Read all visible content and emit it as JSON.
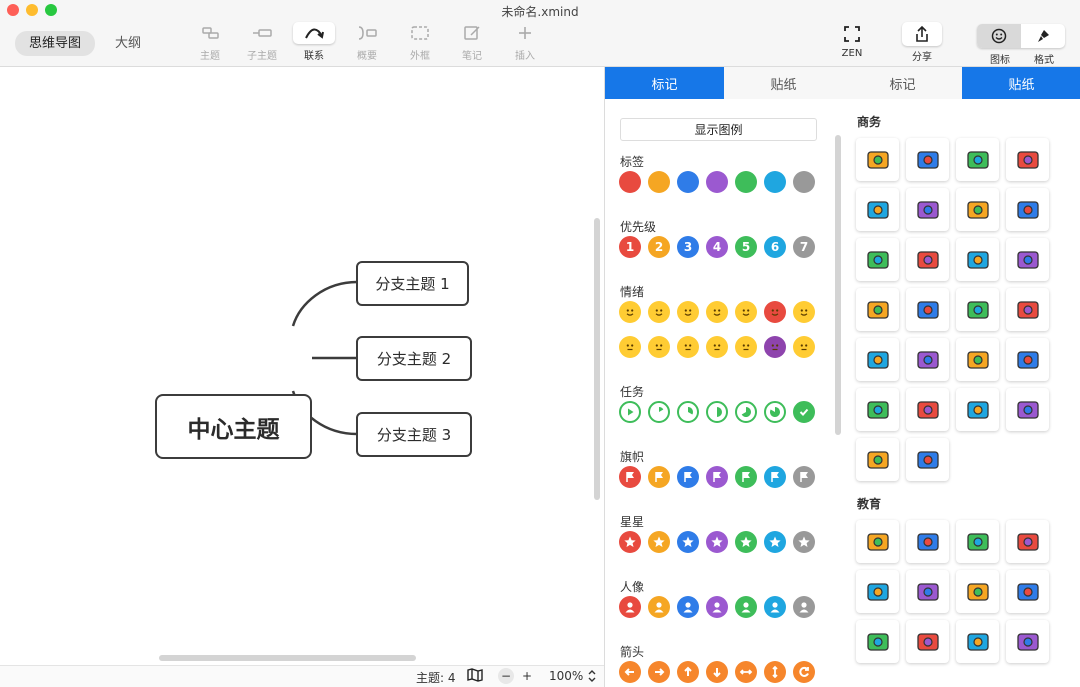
{
  "window": {
    "title": "未命名.xmind"
  },
  "view_tabs": [
    {
      "label": "思维导图",
      "active": true
    },
    {
      "label": "大纲",
      "active": false
    }
  ],
  "toolbar": {
    "topic": "主题",
    "subtopic": "子主题",
    "relationship": "联系",
    "summary": "概要",
    "boundary": "外框",
    "note": "笔记",
    "insert": "插入",
    "zen": "ZEN",
    "share": "分享",
    "icons": "图标",
    "format": "格式"
  },
  "mindmap": {
    "central": "中心主题",
    "branches": [
      "分支主题 1",
      "分支主题 2",
      "分支主题 3"
    ]
  },
  "status": {
    "topics": "主题: 4",
    "zoom": "100%",
    "minus": "−",
    "plus": "+"
  },
  "panel": {
    "tabs": [
      {
        "label": "标记",
        "active": true
      },
      {
        "label": "贴纸",
        "active": false
      },
      {
        "label": "标记",
        "active": false
      },
      {
        "label": "贴纸",
        "active": true
      }
    ],
    "show_legend": "显示图例",
    "marker_sections": {
      "tag": "标签",
      "priority": "优先级",
      "mood": "情绪",
      "task": "任务",
      "flag": "旗帜",
      "star": "星星",
      "person": "人像",
      "arrow": "箭头"
    },
    "palette": [
      "#e84a3f",
      "#f5a623",
      "#2f7ce8",
      "#9b59d0",
      "#3ebd5a",
      "#1fa6e0",
      "#999999"
    ],
    "priority_numbers": [
      "1",
      "2",
      "3",
      "4",
      "5",
      "6",
      "7"
    ],
    "sticker_sections": {
      "business": "商务",
      "education": "教育"
    },
    "business_stickers": [
      "money-icon",
      "briefcase-icon",
      "calculator-icon",
      "chat-bubbles-icon",
      "coffee-icon",
      "id-card-icon",
      "support-agent-icon",
      "mail-icon",
      "document-search-icon",
      "folder-icon",
      "globe-icon",
      "mailbox-icon",
      "vinyl-player-icon",
      "planner-icon",
      "book-icon",
      "presentation-board-icon",
      "printer-icon",
      "analytics-magnifier-icon",
      "target-icon",
      "team-icon",
      "clock-icon",
      "checklist-icon",
      "bar-chart-icon",
      "coins-icon",
      "microphone-icon",
      "badge-icon"
    ],
    "education_stickers": [
      "atom-icon",
      "scales-icon",
      "flasks-icon",
      "newtons-cradle-icon",
      "chalkboard-icon",
      "books-icon",
      "dna-icon",
      "graduation-cap-icon",
      "headphones-icon",
      "flag-stand-icon",
      "glasses-icon",
      "medal-icon"
    ]
  }
}
